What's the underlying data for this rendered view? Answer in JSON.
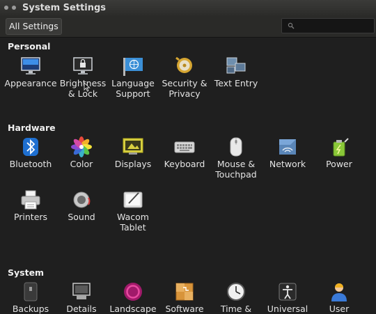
{
  "window": {
    "title": "System Settings"
  },
  "toolbar": {
    "all_settings_label": "All Settings",
    "search_placeholder": ""
  },
  "sections": {
    "personal": {
      "title": "Personal",
      "items": [
        {
          "label": "Appearance",
          "icon": "monitor-icon"
        },
        {
          "label": "Brightness & Lock",
          "icon": "lock-monitor-icon"
        },
        {
          "label": "Language Support",
          "icon": "un-flag-icon"
        },
        {
          "label": "Security & Privacy",
          "icon": "security-icon"
        },
        {
          "label": "Text Entry",
          "icon": "keyboard-layout-icon"
        }
      ]
    },
    "hardware": {
      "title": "Hardware",
      "items": [
        {
          "label": "Bluetooth",
          "icon": "bluetooth-icon"
        },
        {
          "label": "Color",
          "icon": "color-icon"
        },
        {
          "label": "Displays",
          "icon": "displays-icon"
        },
        {
          "label": "Keyboard",
          "icon": "keyboard-icon"
        },
        {
          "label": "Mouse & Touchpad",
          "icon": "mouse-icon"
        },
        {
          "label": "Network",
          "icon": "network-icon"
        },
        {
          "label": "Power",
          "icon": "power-icon"
        },
        {
          "label": "Printers",
          "icon": "printer-icon"
        },
        {
          "label": "Sound",
          "icon": "sound-icon"
        },
        {
          "label": "Wacom Tablet",
          "icon": "tablet-icon"
        }
      ]
    },
    "system": {
      "title": "System",
      "items": [
        {
          "label": "Backups",
          "icon": "backups-icon"
        },
        {
          "label": "Details",
          "icon": "details-icon"
        },
        {
          "label": "Landscape",
          "icon": "landscape-icon"
        },
        {
          "label": "Software",
          "icon": "software-icon"
        },
        {
          "label": "Time &",
          "icon": "clock-icon"
        },
        {
          "label": "Universal",
          "icon": "universal-access-icon"
        },
        {
          "label": "User",
          "icon": "user-icon"
        }
      ]
    }
  }
}
